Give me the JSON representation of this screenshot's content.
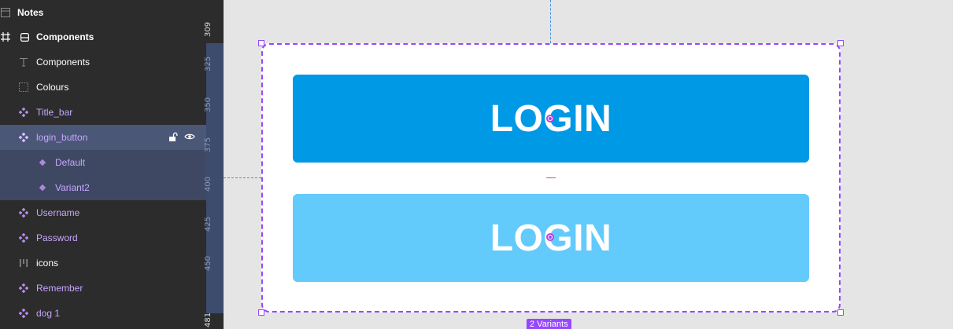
{
  "layers": [
    {
      "name": "Notes",
      "kind": "frame",
      "icon": "frame-icon"
    },
    {
      "name": "Components",
      "kind": "frame",
      "icon": "frame-icon"
    },
    {
      "name": "Components",
      "kind": "text",
      "icon": "text-icon"
    },
    {
      "name": "Colours",
      "kind": "frame",
      "icon": "dashed-frame-icon"
    },
    {
      "name": "Title_bar",
      "kind": "component",
      "icon": "component-icon"
    },
    {
      "name": "login_button",
      "kind": "component-set",
      "icon": "component-icon",
      "selected": true
    },
    {
      "name": "Default",
      "kind": "variant",
      "icon": "variant-icon"
    },
    {
      "name": "Variant2",
      "kind": "variant",
      "icon": "variant-icon"
    },
    {
      "name": "Username",
      "kind": "component",
      "icon": "component-icon"
    },
    {
      "name": "Password",
      "kind": "component",
      "icon": "component-icon"
    },
    {
      "name": "icons",
      "kind": "frame",
      "icon": "columns-icon"
    },
    {
      "name": "Remember",
      "kind": "component",
      "icon": "component-icon"
    },
    {
      "name": "dog 1",
      "kind": "component",
      "icon": "component-icon"
    }
  ],
  "ruler": {
    "ticks": [
      "309",
      "325",
      "350",
      "375",
      "400",
      "425",
      "450",
      "481"
    ]
  },
  "canvas": {
    "variants": [
      {
        "name": "Default",
        "label": "LOGIN",
        "color": "#0099e5"
      },
      {
        "name": "Variant2",
        "label": "LOGIN",
        "color": "#63cafc"
      }
    ],
    "badge": "2 Variants"
  },
  "colors": {
    "selection": "#9747ff",
    "sidebar_bg": "#2c2c2c",
    "selected_row": "#4b5777",
    "component_text": "#c7a6ff"
  }
}
